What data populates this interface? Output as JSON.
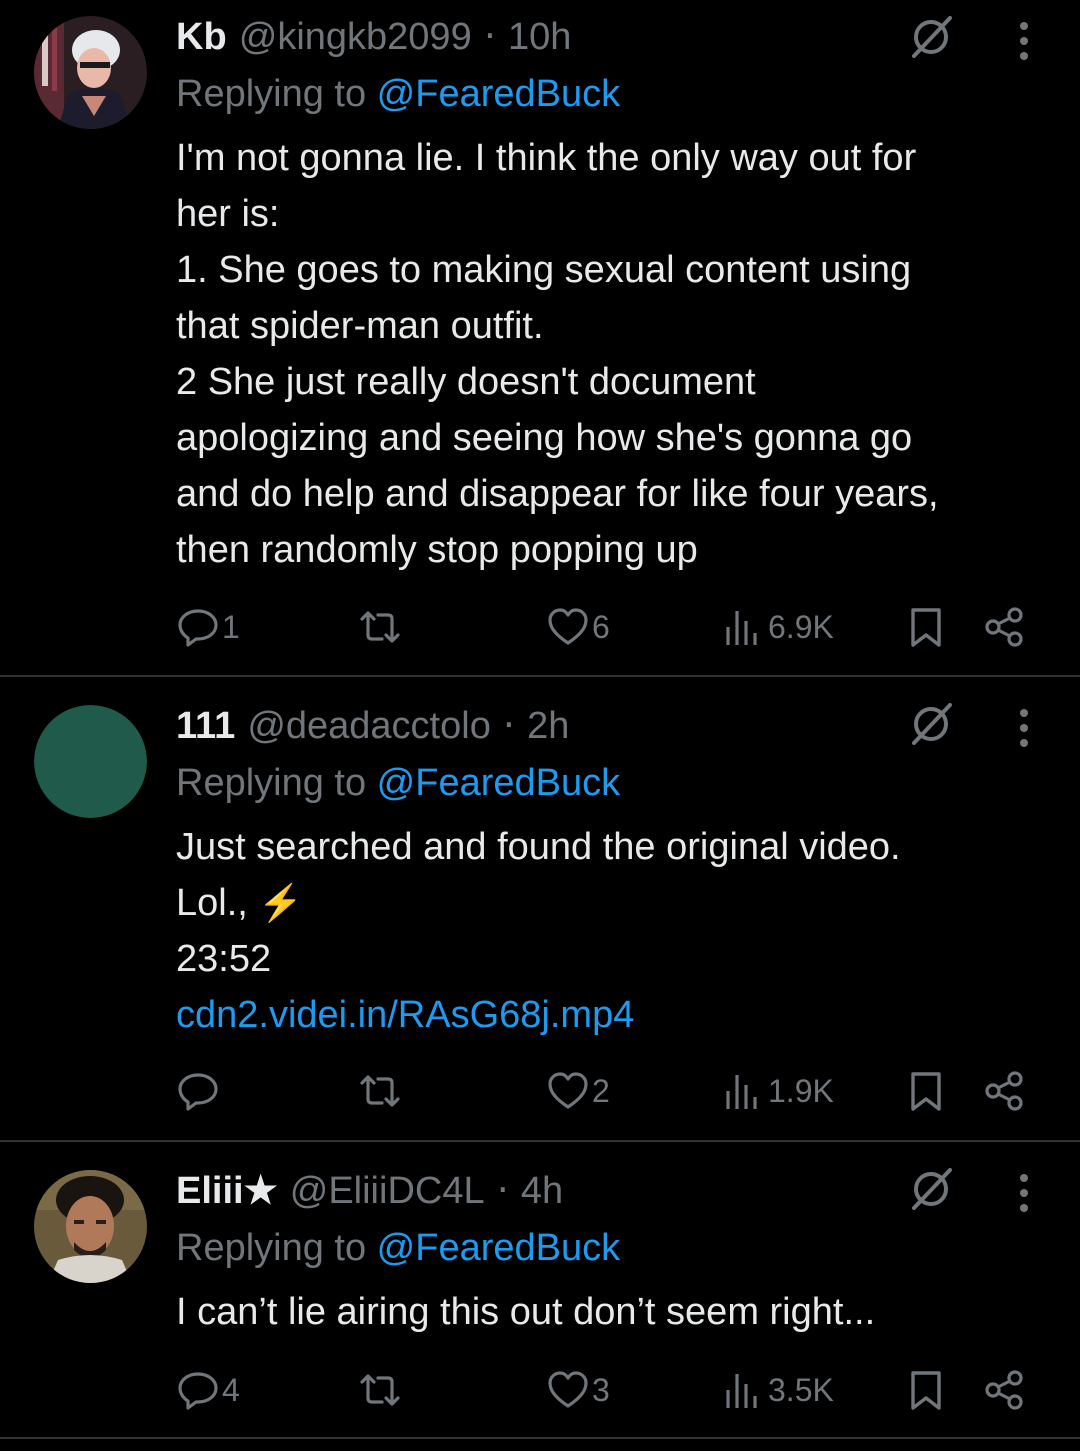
{
  "tweets": [
    {
      "display_name": "Kb",
      "handle": "@kingkb2099",
      "separator": "·",
      "time": "10h",
      "replying_prefix": "Replying to ",
      "replying_to": "@FearedBuck",
      "text_lines": [
        "I'm not gonna lie. I think the only way out  for",
        "her is:",
        "1. She goes to making sexual content using",
        "that spider-man outfit.",
        "2 She just really doesn't document",
        "apologizing and seeing how she's gonna go",
        "and do help and disappear for like four years,",
        "then randomly stop popping  up"
      ],
      "replies": "1",
      "retweets": "",
      "likes": "6",
      "views": "6.9K",
      "avatar_icon": "anime-avatar"
    },
    {
      "display_name": "111",
      "handle": "@deadacctolo",
      "separator": "·",
      "time": "2h",
      "replying_prefix": "Replying to ",
      "replying_to": "@FearedBuck",
      "text_lines": [
        "Just searched and found the original video.",
        "Lol., ",
        "23:52"
      ],
      "emoji": "⚡",
      "link": "cdn2.videi.in/RAsG68j.mp4",
      "replies": "",
      "retweets": "",
      "likes": "2",
      "views": "1.9K",
      "avatar_color": "#1f5a4a"
    },
    {
      "display_name": "Eliii★",
      "handle": "@EliiiDC4L",
      "separator": "·",
      "time": "4h",
      "replying_prefix": "Replying to ",
      "replying_to": "@FearedBuck",
      "text_lines": [
        "I can’t lie airing this out don’t seem right..."
      ],
      "replies": "4",
      "retweets": "",
      "likes": "3",
      "views": "3.5K",
      "avatar_icon": "photo-avatar"
    }
  ],
  "colors": {
    "background": "#000000",
    "text": "#e7e9ea",
    "secondary": "#71767b",
    "link": "#1d9bf0",
    "divider": "#2f3336"
  }
}
